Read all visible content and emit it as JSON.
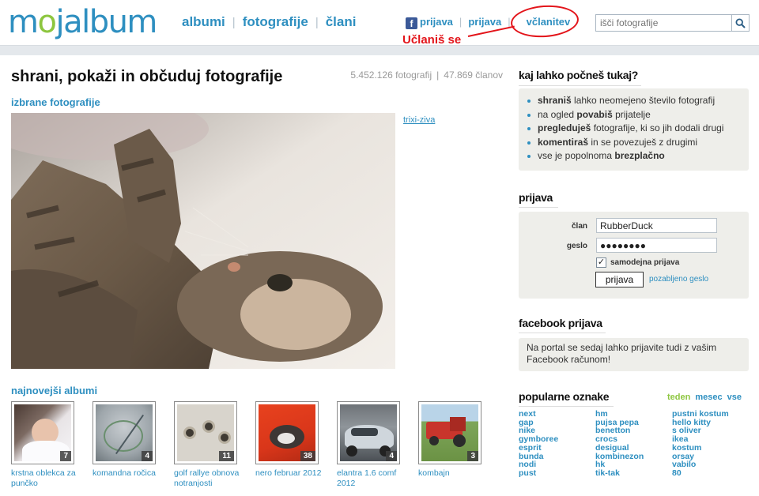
{
  "header": {
    "logo": {
      "part1": "m",
      "part2": "o",
      "part3": "jalbum"
    },
    "nav": [
      "albumi",
      "fotografije",
      "člani"
    ],
    "top_links": {
      "fb_login": "prijava",
      "login": "prijava",
      "register": "včlanitev"
    },
    "annotation": "Učlaniš se",
    "search": {
      "placeholder": "išči fotografije"
    }
  },
  "main": {
    "title": "shrani, pokaži in občuduj fotografije",
    "stats": {
      "photos": "5.452.126 fotografij",
      "members": "47.869 članov"
    },
    "featured": {
      "heading": "izbrane fotografije",
      "credit": "trixi-ziva"
    },
    "albums": {
      "heading": "najnovejši albumi",
      "items": [
        {
          "label": "krstna oblekca za punčko",
          "count": "7"
        },
        {
          "label": "komandna ročica",
          "count": "4"
        },
        {
          "label": "golf rallye obnova notranjosti",
          "count": "11"
        },
        {
          "label": "nero februar 2012",
          "count": "38"
        },
        {
          "label": "elantra 1.6 comf 2012",
          "count": "4"
        },
        {
          "label": "kombajn",
          "count": "3"
        }
      ]
    }
  },
  "sidebar": {
    "what_heading": "kaj lahko počneš tukaj?",
    "benefits": [
      {
        "bold": "shraniš",
        "text": " lahko neomejeno število fotografij",
        "pre": ""
      },
      {
        "pre": "na ogled ",
        "bold": "povabiš",
        "text": " prijatelje"
      },
      {
        "pre": "",
        "bold": "pregleduješ",
        "text": " fotografije, ki so jih dodali drugi"
      },
      {
        "pre": "",
        "bold": "komentiraš",
        "text": " in se povezuješ z drugimi"
      },
      {
        "pre": "vse je popolnoma ",
        "bold": "brezplačno",
        "text": ""
      }
    ],
    "login": {
      "heading": "prijava",
      "user_label": "član",
      "user_value": "RubberDuck",
      "pass_label": "geslo",
      "pass_value": "●●●●●●●●",
      "remember_label": "samodejna prijava",
      "remember_checked": true,
      "submit": "prijava",
      "forgot": "pozabljeno geslo"
    },
    "facebook": {
      "heading": "facebook prijava",
      "text": "Na portal se sedaj lahko prijavite tudi z vašim Facebook računom!"
    },
    "tags": {
      "heading": "popularne oznake",
      "tabs": [
        "teden",
        "mesec",
        "vse"
      ],
      "active_tab": "teden",
      "col1": [
        "next",
        "gap",
        "nike",
        "gymboree",
        "esprit",
        "bunda",
        "nodi",
        "pust"
      ],
      "col2": [
        "hm",
        "pujsa pepa",
        "benetton",
        "crocs",
        "desigual",
        "kombinezon",
        "hk",
        "tik-tak"
      ],
      "col3": [
        "pustni kostum",
        "hello kitty",
        "s oliver",
        "ikea",
        "kostum",
        "orsay",
        "vabilo",
        "80"
      ]
    }
  },
  "colors": {
    "brand_blue": "#2e8fc0",
    "brand_green": "#8dc63f",
    "annotation_red": "#e3141a",
    "facebook": "#3b5998"
  }
}
